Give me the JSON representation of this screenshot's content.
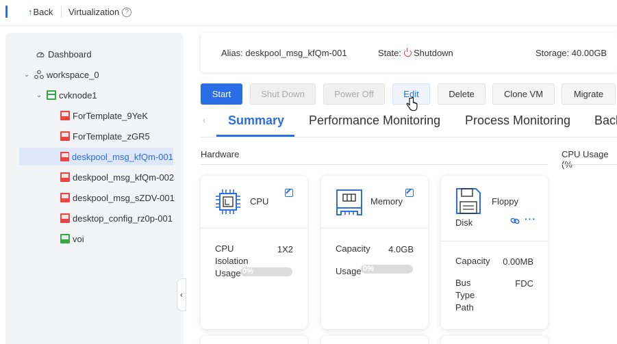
{
  "topbar": {
    "back_label": "Back",
    "back_arrow": "↑",
    "title": "Virtualization",
    "help_glyph": "?"
  },
  "sidebar": {
    "items": [
      {
        "label": "Dashboard"
      },
      {
        "label": "workspace_0"
      },
      {
        "label": "cvknode1"
      },
      {
        "label": "ForTemplate_9YeK"
      },
      {
        "label": "ForTemplate_zGR5"
      },
      {
        "label": "deskpool_msg_kfQm-001"
      },
      {
        "label": "deskpool_msg_kfQm-002"
      },
      {
        "label": "deskpool_msg_sZDV-001"
      },
      {
        "label": "desktop_config_rz0p-001"
      },
      {
        "label": "voi"
      }
    ],
    "collapse_glyph": "‹"
  },
  "info": {
    "alias_label": "Alias:",
    "alias_value": "deskpool_msg_kfQm-001",
    "state_label": "State:",
    "state_value": "Shutdown",
    "storage_label": "Storage:",
    "storage_value": "40.00GB"
  },
  "actions": {
    "start": "Start",
    "shutdown": "Shut Down",
    "poweroff": "Power Off",
    "edit": "Edit",
    "delete": "Delete",
    "clone": "Clone VM",
    "migrate": "Migrate"
  },
  "tabs": {
    "prev_glyph": "‹",
    "items": [
      {
        "label": "Summary",
        "active": true
      },
      {
        "label": "Performance Monitoring"
      },
      {
        "label": "Process Monitoring"
      },
      {
        "label": "Back"
      }
    ]
  },
  "sections": {
    "hardware": "Hardware",
    "cpu_usage": "CPU Usage (%"
  },
  "cards": {
    "cpu": {
      "title": "CPU",
      "cpu_label": "CPU",
      "cpu_value": "1X2",
      "isolation_label": "Isolation",
      "usage_label": "Usage",
      "usage_text": "0%",
      "usage_fraction": 0.0
    },
    "memory": {
      "title": "Memory",
      "capacity_label": "Capacity",
      "capacity_value": "4.0GB",
      "usage_label": "Usage",
      "usage_text": "0%",
      "usage_fraction": 0.0
    },
    "floppy": {
      "title_line1": "Floppy",
      "title_line2": "Disk",
      "capacity_label": "Capacity",
      "capacity_value": "0.00MB",
      "bus_label": "Bus",
      "bus_value": "FDC",
      "type_label": "Type",
      "path_label": "Path"
    }
  },
  "colors": {
    "accent": "#2b6de5",
    "danger": "#e84545",
    "ok": "#3aa548"
  }
}
